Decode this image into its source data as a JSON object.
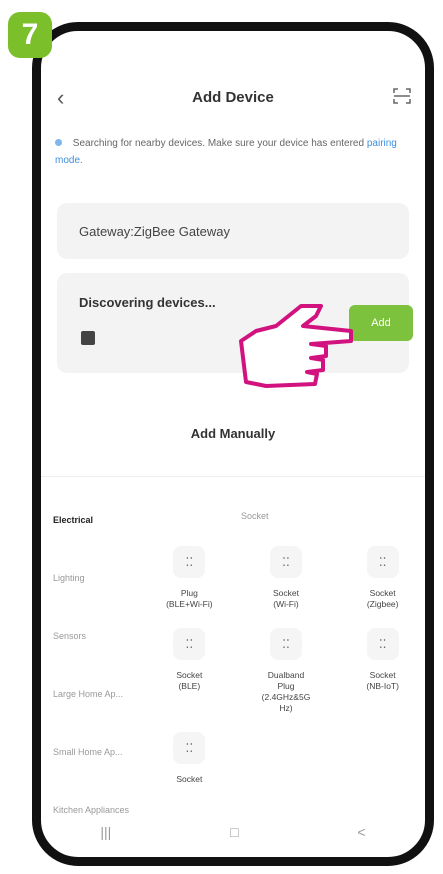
{
  "step_badge": "7",
  "header": {
    "title": "Add Device"
  },
  "hint": {
    "text": "Searching for nearby devices. Make sure your device has entered ",
    "link": "pairing mode."
  },
  "gateway": {
    "label": "Gateway:ZigBee Gateway"
  },
  "discovering": {
    "title": "Discovering devices...",
    "add_label": "Add"
  },
  "add_manually": "Add Manually",
  "sidebar": {
    "items": [
      {
        "label": "Electrical",
        "active": true
      },
      {
        "label": "Lighting"
      },
      {
        "label": "Sensors"
      },
      {
        "label": "Large\nHome Ap..."
      },
      {
        "label": "Small\nHome Ap..."
      },
      {
        "label": "Kitchen\nAppliances"
      }
    ]
  },
  "section_title": "Socket",
  "devices": [
    {
      "label": "Plug\n(BLE+Wi-Fi)"
    },
    {
      "label": "Socket\n(Wi-Fi)"
    },
    {
      "label": "Socket\n(Zigbee)"
    },
    {
      "label": "Socket\n(BLE)"
    },
    {
      "label": "Dualband\nPlug\n(2.4GHz&5G\nHz)"
    },
    {
      "label": "Socket\n(NB-IoT)"
    },
    {
      "label": "Socket"
    }
  ],
  "bottom_nav": {
    "recent": "|||",
    "home": "□",
    "back": "<"
  }
}
